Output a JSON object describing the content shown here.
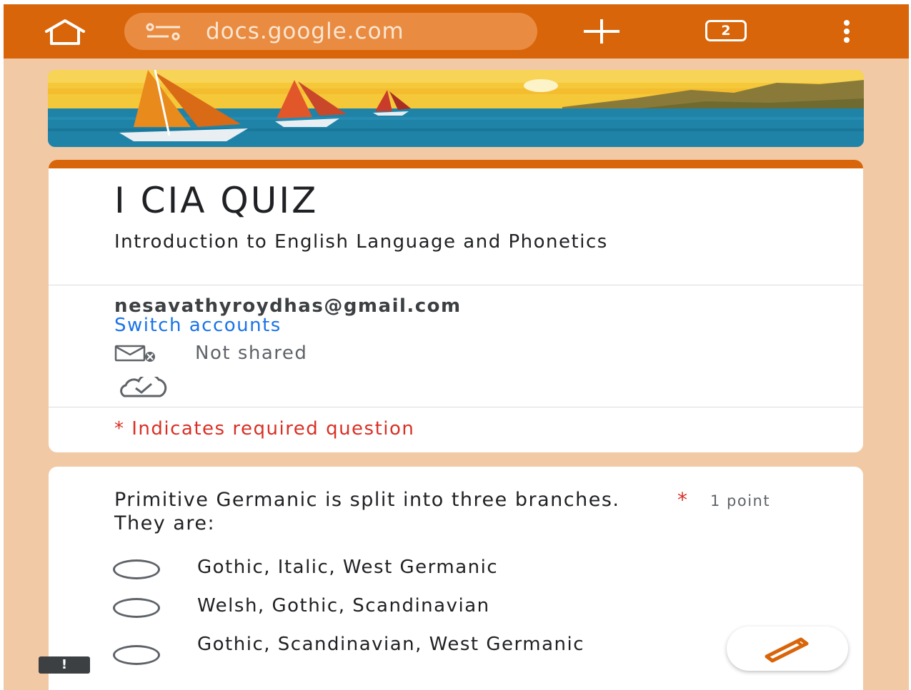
{
  "browser": {
    "url": "docs.google.com",
    "tab_count": "2",
    "icons": [
      "home-icon",
      "site-settings-icon",
      "new-tab-icon",
      "tab-switcher-icon",
      "more-menu-icon"
    ],
    "accent_color": "#d9650a"
  },
  "form": {
    "title": "I CIA QUIZ",
    "description": "Introduction to English Language and Phonetics",
    "email": "nesavathyroydhas@gmail.com",
    "switch_accounts": "Switch accounts",
    "not_shared": "Not shared",
    "required_note": "* Indicates required question",
    "banner_icon": "sailboats-banner"
  },
  "question": {
    "text": "Primitive Germanic is split into three branches. They are:",
    "required_marker": "*",
    "points": "1 point",
    "options": [
      {
        "label": "Gothic, Italic, West Germanic"
      },
      {
        "label": "Welsh, Gothic, Scandinavian"
      },
      {
        "label": "Gothic, Scandinavian, West Germanic"
      }
    ]
  },
  "floating": {
    "edit_icon": "pencil-icon",
    "feedback_icon": "report-icon",
    "feedback_glyph": "!"
  }
}
